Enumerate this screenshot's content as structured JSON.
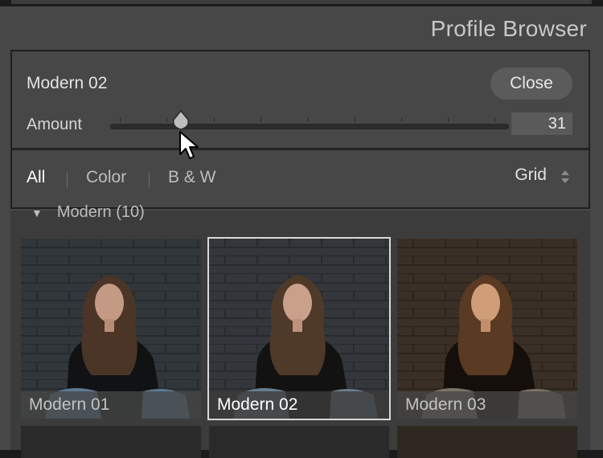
{
  "panel": {
    "title": "Profile Browser"
  },
  "profile": {
    "name": "Modern 02",
    "close_label": "Close"
  },
  "amount": {
    "label": "Amount",
    "value": "31",
    "level": 0.31
  },
  "filters": {
    "tabs": [
      {
        "label": "All",
        "active": true
      },
      {
        "label": "Color",
        "active": false
      },
      {
        "label": "B & W",
        "active": false
      }
    ],
    "view": "Grid"
  },
  "group": {
    "label": "Modern (10)"
  },
  "thumbnails": [
    {
      "label": "Modern 01",
      "selected": false,
      "tone": "cool"
    },
    {
      "label": "Modern 02",
      "selected": true,
      "tone": "neutral"
    },
    {
      "label": "Modern 03",
      "selected": false,
      "tone": "warm"
    }
  ],
  "icons": {
    "cursor": "arrow-cursor-icon",
    "collapse": "disclosure-triangle-icon",
    "view_toggle": "up-down-arrows-icon"
  }
}
